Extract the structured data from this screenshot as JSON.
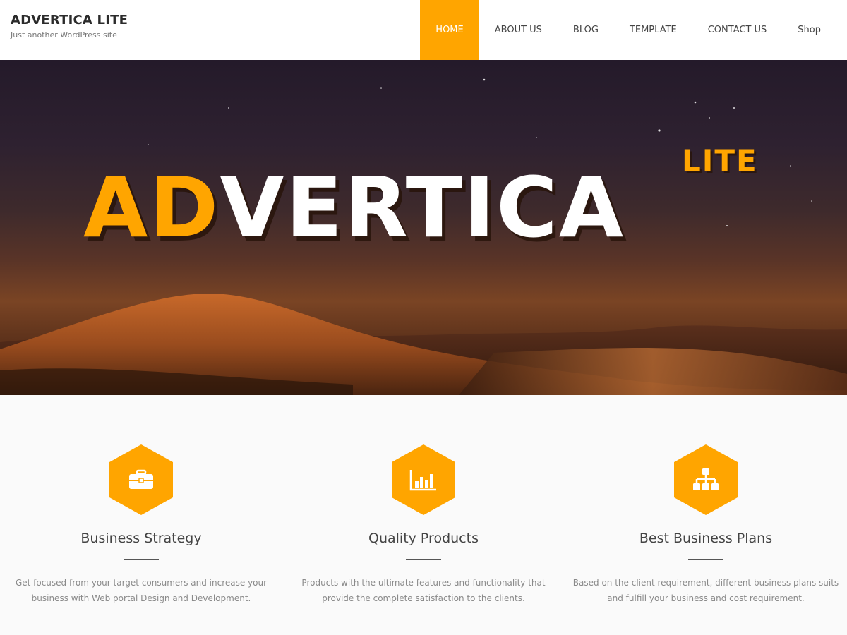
{
  "header": {
    "site_title": "ADVERTICA LITE",
    "tagline": "Just another WordPress site"
  },
  "nav": {
    "items": [
      {
        "label": "HOME",
        "active": true
      },
      {
        "label": "ABOUT US",
        "active": false
      },
      {
        "label": "BLOG",
        "active": false
      },
      {
        "label": "TEMPLATE",
        "active": false
      },
      {
        "label": "CONTACT US",
        "active": false
      },
      {
        "label": "Shop",
        "active": false
      }
    ]
  },
  "hero": {
    "logo_ad": "AD",
    "logo_rest": "VERTICA",
    "logo_lite": "LITE"
  },
  "features": [
    {
      "icon": "briefcase-icon",
      "title": "Business Strategy",
      "text": "Get focused from your target consumers and increase your business with Web portal Design and Development."
    },
    {
      "icon": "bar-chart-icon",
      "title": "Quality Products",
      "text": "Products with the ultimate features and functionality that provide the complete satisfaction to the clients."
    },
    {
      "icon": "sitemap-icon",
      "title": "Best Business Plans",
      "text": "Based on the client requirement, different business plans suits and fulfill your business and cost requirement."
    }
  ],
  "colors": {
    "accent": "#ffa500",
    "header_bg": "#ffffff",
    "text_dark": "#444444",
    "text_muted": "#8a8a8a"
  }
}
